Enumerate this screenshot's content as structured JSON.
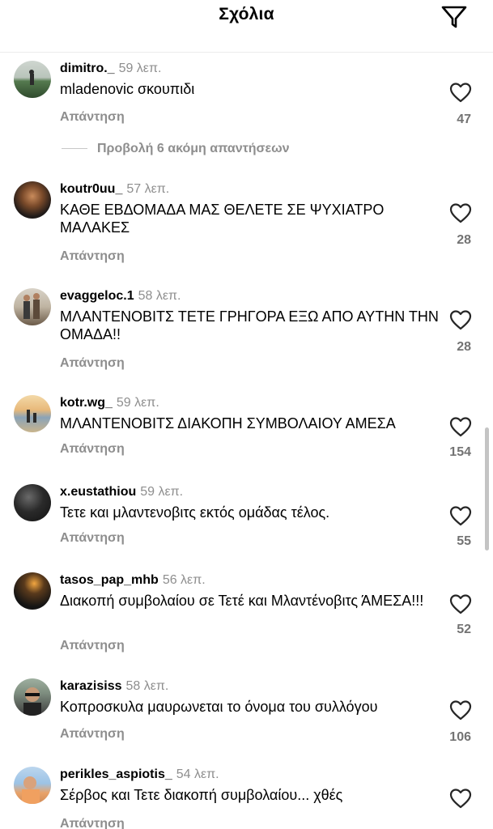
{
  "header": {
    "title": "Σχόλια"
  },
  "view_more_label": "Προβολή 6 ακόμη απαντήσεων",
  "comments": [
    {
      "username": "dimitro._",
      "time": "59 λεπ.",
      "text": "mladenovic σκουπιδι",
      "reply": "Απάντηση",
      "likes": "47"
    },
    {
      "username": "koutr0uu_",
      "time": "57 λεπ.",
      "text": "ΚΑΘΕ ΕΒΔΟΜΑΔΑ ΜΑΣ ΘΕΛΕΤΕ ΣΕ ΨΥΧΙΑΤΡΟ ΜΑΛΑΚΕΣ",
      "reply": "Απάντηση",
      "likes": "28"
    },
    {
      "username": "evaggeloc.1",
      "time": "58 λεπ.",
      "text": "ΜΛΑΝΤΕΝΟΒΙΤΣ ΤΕΤΕ ΓΡΗΓΟΡΑ ΕΞΩ ΑΠΟ ΑΥΤΗΝ ΤΗΝ ΟΜΑΔΑ!!",
      "reply": "Απάντηση",
      "likes": "28"
    },
    {
      "username": "kotr.wg_",
      "time": "59 λεπ.",
      "text": "ΜΛΑΝΤΕΝΟΒΙΤΣ ΔΙΑΚΟΠΗ ΣΥΜΒΟΛΑΙΟΥ ΑΜΕΣΑ",
      "reply": "Απάντηση",
      "likes": "154"
    },
    {
      "username": "x.eustathiou",
      "time": "59 λεπ.",
      "text": "Τετε και μλαντενοβιτς εκτός ομάδας τέλος.",
      "reply": "Απάντηση",
      "likes": "55"
    },
    {
      "username": "tasos_pap_mhb",
      "time": "56 λεπ.",
      "text": "Διακοπή συμβολαίου σε Τετέ και Μλαντένοβιτς ΆΜΕΣΑ!!!",
      "reply": "Απάντηση",
      "likes": "52"
    },
    {
      "username": "karazisiss",
      "time": "58 λεπ.",
      "text": "Κοπροσκυλα μαυρωνεται το όνομα του συλλόγου",
      "reply": "Απάντηση",
      "likes": "106"
    },
    {
      "username": "perikles_aspiotis_",
      "time": "54 λεπ.",
      "text": "Σέρβος και Τετε διακοπή συμβολαίου... χθές",
      "reply": "Απάντηση",
      "likes": ""
    }
  ]
}
